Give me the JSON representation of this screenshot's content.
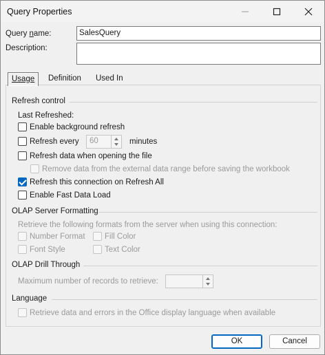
{
  "window": {
    "title": "Query Properties",
    "controls": [
      "minimize-icon",
      "maximize-icon",
      "close-icon"
    ]
  },
  "query_name": {
    "label_pre": "Query ",
    "label_ul": "n",
    "label_post": "ame:",
    "value": "SalesQuery"
  },
  "description": {
    "label": "Description:",
    "value": ""
  },
  "tabs": [
    {
      "label": "Usage",
      "active": true
    },
    {
      "label": "Definition",
      "active": false
    },
    {
      "label": "Used In",
      "active": false
    }
  ],
  "refresh_control": {
    "heading": "Refresh control",
    "last_refreshed": "Last Refreshed:",
    "background_refresh": {
      "label": "Enable background refresh",
      "checked": false
    },
    "refresh_every": {
      "label": "Refresh every",
      "value": "60",
      "unit": "minutes",
      "checked": false
    },
    "refresh_on_open": {
      "label": "Refresh data when opening the file",
      "checked": false
    },
    "remove_data": {
      "label": "Remove data from the external data range before saving the workbook",
      "checked": false,
      "disabled": true
    },
    "refresh_all": {
      "label": "Refresh this connection on Refresh All",
      "checked": true
    },
    "fast_load": {
      "label": "Enable Fast Data Load",
      "checked": false
    }
  },
  "olap_formatting": {
    "heading": "OLAP Server Formatting",
    "description": "Retrieve the following formats from the server when using this connection:",
    "number_format": "Number Format",
    "fill_color": "Fill Color",
    "font_style": "Font Style",
    "text_color": "Text Color"
  },
  "olap_drill": {
    "heading": "OLAP Drill Through",
    "max_records_label": "Maximum number of records to retrieve:",
    "max_records_value": ""
  },
  "language": {
    "heading": "Language",
    "retrieve_label": "Retrieve data and errors in the Office display language when available"
  },
  "buttons": {
    "ok": "OK",
    "cancel": "Cancel"
  },
  "colors": {
    "accent": "#0067c0",
    "disabled_text": "#9a9a9a"
  }
}
